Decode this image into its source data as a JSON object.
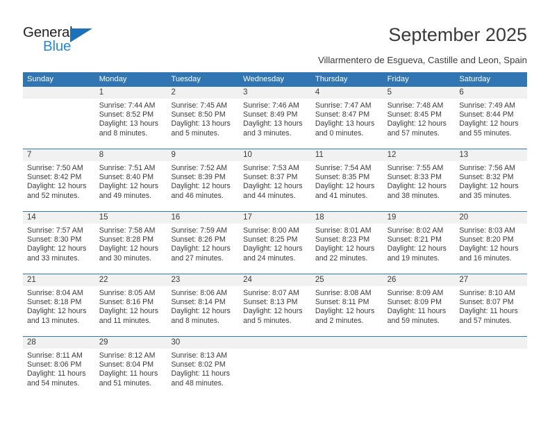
{
  "brand": {
    "name_top": "General",
    "name_bottom": "Blue",
    "triangle_color": "#1b72b8",
    "blue_text_color": "#2789d2"
  },
  "header": {
    "title": "September 2025",
    "location": "Villarmentero de Esgueva, Castille and Leon, Spain"
  },
  "theme": {
    "header_blue": "#3175b3",
    "daynum_band": "#f1f1f1",
    "text": "#3a3a3a"
  },
  "weekday_headers": [
    "Sunday",
    "Monday",
    "Tuesday",
    "Wednesday",
    "Thursday",
    "Friday",
    "Saturday"
  ],
  "weeks": [
    {
      "days": [
        {
          "num": "",
          "sunrise": "",
          "sunset": "",
          "daylight_line1": "",
          "daylight_line2": "",
          "empty": true
        },
        {
          "num": "1",
          "sunrise": "Sunrise: 7:44 AM",
          "sunset": "Sunset: 8:52 PM",
          "daylight_line1": "Daylight: 13 hours",
          "daylight_line2": "and 8 minutes.",
          "empty": false
        },
        {
          "num": "2",
          "sunrise": "Sunrise: 7:45 AM",
          "sunset": "Sunset: 8:50 PM",
          "daylight_line1": "Daylight: 13 hours",
          "daylight_line2": "and 5 minutes.",
          "empty": false
        },
        {
          "num": "3",
          "sunrise": "Sunrise: 7:46 AM",
          "sunset": "Sunset: 8:49 PM",
          "daylight_line1": "Daylight: 13 hours",
          "daylight_line2": "and 3 minutes.",
          "empty": false
        },
        {
          "num": "4",
          "sunrise": "Sunrise: 7:47 AM",
          "sunset": "Sunset: 8:47 PM",
          "daylight_line1": "Daylight: 13 hours",
          "daylight_line2": "and 0 minutes.",
          "empty": false
        },
        {
          "num": "5",
          "sunrise": "Sunrise: 7:48 AM",
          "sunset": "Sunset: 8:45 PM",
          "daylight_line1": "Daylight: 12 hours",
          "daylight_line2": "and 57 minutes.",
          "empty": false
        },
        {
          "num": "6",
          "sunrise": "Sunrise: 7:49 AM",
          "sunset": "Sunset: 8:44 PM",
          "daylight_line1": "Daylight: 12 hours",
          "daylight_line2": "and 55 minutes.",
          "empty": false
        }
      ]
    },
    {
      "days": [
        {
          "num": "7",
          "sunrise": "Sunrise: 7:50 AM",
          "sunset": "Sunset: 8:42 PM",
          "daylight_line1": "Daylight: 12 hours",
          "daylight_line2": "and 52 minutes.",
          "empty": false
        },
        {
          "num": "8",
          "sunrise": "Sunrise: 7:51 AM",
          "sunset": "Sunset: 8:40 PM",
          "daylight_line1": "Daylight: 12 hours",
          "daylight_line2": "and 49 minutes.",
          "empty": false
        },
        {
          "num": "9",
          "sunrise": "Sunrise: 7:52 AM",
          "sunset": "Sunset: 8:39 PM",
          "daylight_line1": "Daylight: 12 hours",
          "daylight_line2": "and 46 minutes.",
          "empty": false
        },
        {
          "num": "10",
          "sunrise": "Sunrise: 7:53 AM",
          "sunset": "Sunset: 8:37 PM",
          "daylight_line1": "Daylight: 12 hours",
          "daylight_line2": "and 44 minutes.",
          "empty": false
        },
        {
          "num": "11",
          "sunrise": "Sunrise: 7:54 AM",
          "sunset": "Sunset: 8:35 PM",
          "daylight_line1": "Daylight: 12 hours",
          "daylight_line2": "and 41 minutes.",
          "empty": false
        },
        {
          "num": "12",
          "sunrise": "Sunrise: 7:55 AM",
          "sunset": "Sunset: 8:33 PM",
          "daylight_line1": "Daylight: 12 hours",
          "daylight_line2": "and 38 minutes.",
          "empty": false
        },
        {
          "num": "13",
          "sunrise": "Sunrise: 7:56 AM",
          "sunset": "Sunset: 8:32 PM",
          "daylight_line1": "Daylight: 12 hours",
          "daylight_line2": "and 35 minutes.",
          "empty": false
        }
      ]
    },
    {
      "days": [
        {
          "num": "14",
          "sunrise": "Sunrise: 7:57 AM",
          "sunset": "Sunset: 8:30 PM",
          "daylight_line1": "Daylight: 12 hours",
          "daylight_line2": "and 33 minutes.",
          "empty": false
        },
        {
          "num": "15",
          "sunrise": "Sunrise: 7:58 AM",
          "sunset": "Sunset: 8:28 PM",
          "daylight_line1": "Daylight: 12 hours",
          "daylight_line2": "and 30 minutes.",
          "empty": false
        },
        {
          "num": "16",
          "sunrise": "Sunrise: 7:59 AM",
          "sunset": "Sunset: 8:26 PM",
          "daylight_line1": "Daylight: 12 hours",
          "daylight_line2": "and 27 minutes.",
          "empty": false
        },
        {
          "num": "17",
          "sunrise": "Sunrise: 8:00 AM",
          "sunset": "Sunset: 8:25 PM",
          "daylight_line1": "Daylight: 12 hours",
          "daylight_line2": "and 24 minutes.",
          "empty": false
        },
        {
          "num": "18",
          "sunrise": "Sunrise: 8:01 AM",
          "sunset": "Sunset: 8:23 PM",
          "daylight_line1": "Daylight: 12 hours",
          "daylight_line2": "and 22 minutes.",
          "empty": false
        },
        {
          "num": "19",
          "sunrise": "Sunrise: 8:02 AM",
          "sunset": "Sunset: 8:21 PM",
          "daylight_line1": "Daylight: 12 hours",
          "daylight_line2": "and 19 minutes.",
          "empty": false
        },
        {
          "num": "20",
          "sunrise": "Sunrise: 8:03 AM",
          "sunset": "Sunset: 8:20 PM",
          "daylight_line1": "Daylight: 12 hours",
          "daylight_line2": "and 16 minutes.",
          "empty": false
        }
      ]
    },
    {
      "days": [
        {
          "num": "21",
          "sunrise": "Sunrise: 8:04 AM",
          "sunset": "Sunset: 8:18 PM",
          "daylight_line1": "Daylight: 12 hours",
          "daylight_line2": "and 13 minutes.",
          "empty": false
        },
        {
          "num": "22",
          "sunrise": "Sunrise: 8:05 AM",
          "sunset": "Sunset: 8:16 PM",
          "daylight_line1": "Daylight: 12 hours",
          "daylight_line2": "and 11 minutes.",
          "empty": false
        },
        {
          "num": "23",
          "sunrise": "Sunrise: 8:06 AM",
          "sunset": "Sunset: 8:14 PM",
          "daylight_line1": "Daylight: 12 hours",
          "daylight_line2": "and 8 minutes.",
          "empty": false
        },
        {
          "num": "24",
          "sunrise": "Sunrise: 8:07 AM",
          "sunset": "Sunset: 8:13 PM",
          "daylight_line1": "Daylight: 12 hours",
          "daylight_line2": "and 5 minutes.",
          "empty": false
        },
        {
          "num": "25",
          "sunrise": "Sunrise: 8:08 AM",
          "sunset": "Sunset: 8:11 PM",
          "daylight_line1": "Daylight: 12 hours",
          "daylight_line2": "and 2 minutes.",
          "empty": false
        },
        {
          "num": "26",
          "sunrise": "Sunrise: 8:09 AM",
          "sunset": "Sunset: 8:09 PM",
          "daylight_line1": "Daylight: 11 hours",
          "daylight_line2": "and 59 minutes.",
          "empty": false
        },
        {
          "num": "27",
          "sunrise": "Sunrise: 8:10 AM",
          "sunset": "Sunset: 8:07 PM",
          "daylight_line1": "Daylight: 11 hours",
          "daylight_line2": "and 57 minutes.",
          "empty": false
        }
      ]
    },
    {
      "days": [
        {
          "num": "28",
          "sunrise": "Sunrise: 8:11 AM",
          "sunset": "Sunset: 8:06 PM",
          "daylight_line1": "Daylight: 11 hours",
          "daylight_line2": "and 54 minutes.",
          "empty": false
        },
        {
          "num": "29",
          "sunrise": "Sunrise: 8:12 AM",
          "sunset": "Sunset: 8:04 PM",
          "daylight_line1": "Daylight: 11 hours",
          "daylight_line2": "and 51 minutes.",
          "empty": false
        },
        {
          "num": "30",
          "sunrise": "Sunrise: 8:13 AM",
          "sunset": "Sunset: 8:02 PM",
          "daylight_line1": "Daylight: 11 hours",
          "daylight_line2": "and 48 minutes.",
          "empty": false
        },
        {
          "num": "",
          "sunrise": "",
          "sunset": "",
          "daylight_line1": "",
          "daylight_line2": "",
          "empty": true
        },
        {
          "num": "",
          "sunrise": "",
          "sunset": "",
          "daylight_line1": "",
          "daylight_line2": "",
          "empty": true
        },
        {
          "num": "",
          "sunrise": "",
          "sunset": "",
          "daylight_line1": "",
          "daylight_line2": "",
          "empty": true
        },
        {
          "num": "",
          "sunrise": "",
          "sunset": "",
          "daylight_line1": "",
          "daylight_line2": "",
          "empty": true
        }
      ]
    }
  ]
}
